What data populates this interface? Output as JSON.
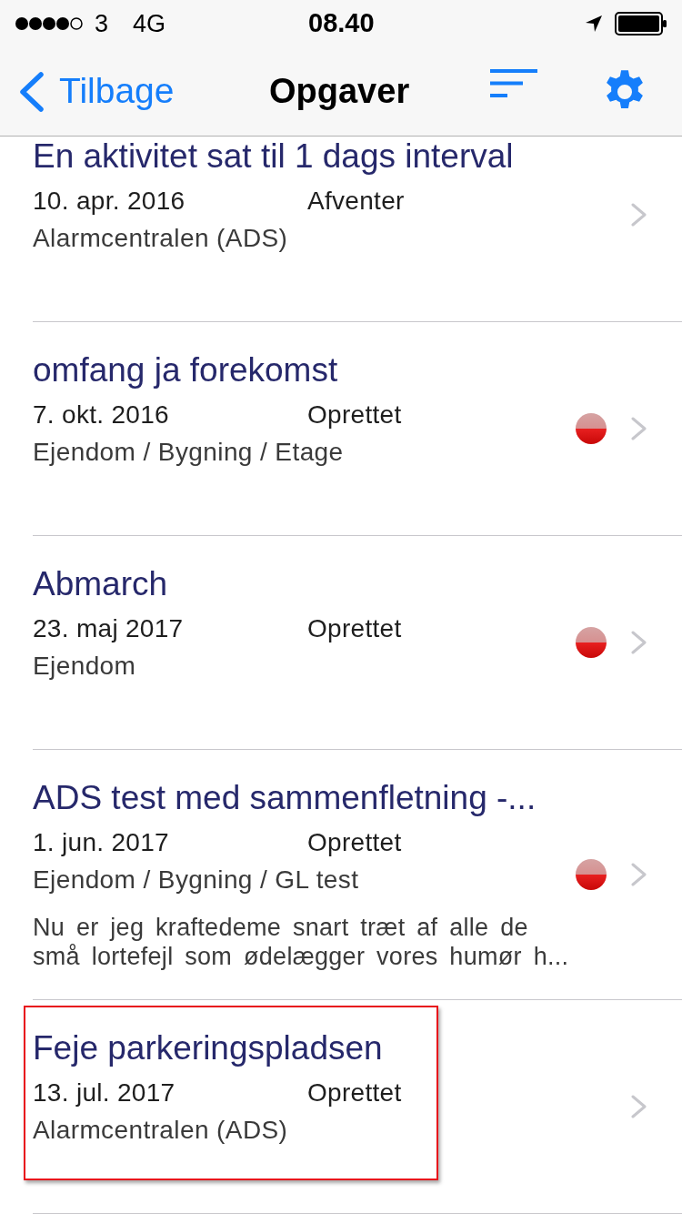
{
  "status_bar": {
    "carrier": "3",
    "network": "4G",
    "time": "08.40"
  },
  "nav_bar": {
    "back": "Tilbage",
    "title": "Opgaver"
  },
  "rows": [
    {
      "title": "En aktivitet sat til 1 dags interval",
      "date": "10. apr. 2016",
      "status": "Afventer",
      "location": "Alarmcentralen (ADS)",
      "flagged": false,
      "highlighted": false
    },
    {
      "title": "omfang ja forekomst",
      "date": "7. okt. 2016",
      "status": "Oprettet",
      "location": "Ejendom / Bygning / Etage",
      "flagged": true,
      "highlighted": false
    },
    {
      "title": "Abmarch",
      "date": "23. maj 2017",
      "status": "Oprettet",
      "location": "Ejendom",
      "flagged": true,
      "highlighted": false
    },
    {
      "title": "ADS test med sammenfletning -...",
      "date": "1. jun. 2017",
      "status": "Oprettet",
      "location": "Ejendom / Bygning / GL test",
      "note": "Nu er jeg kraftedeme snart træt af alle de små lortefejl som ødelægger vores humør h...",
      "flagged": true,
      "highlighted": false
    },
    {
      "title": "Feje parkeringspladsen",
      "date": "13. jul. 2017",
      "status": "Oprettet",
      "location": "Alarmcentralen (ADS)",
      "flagged": false,
      "highlighted": true
    }
  ]
}
